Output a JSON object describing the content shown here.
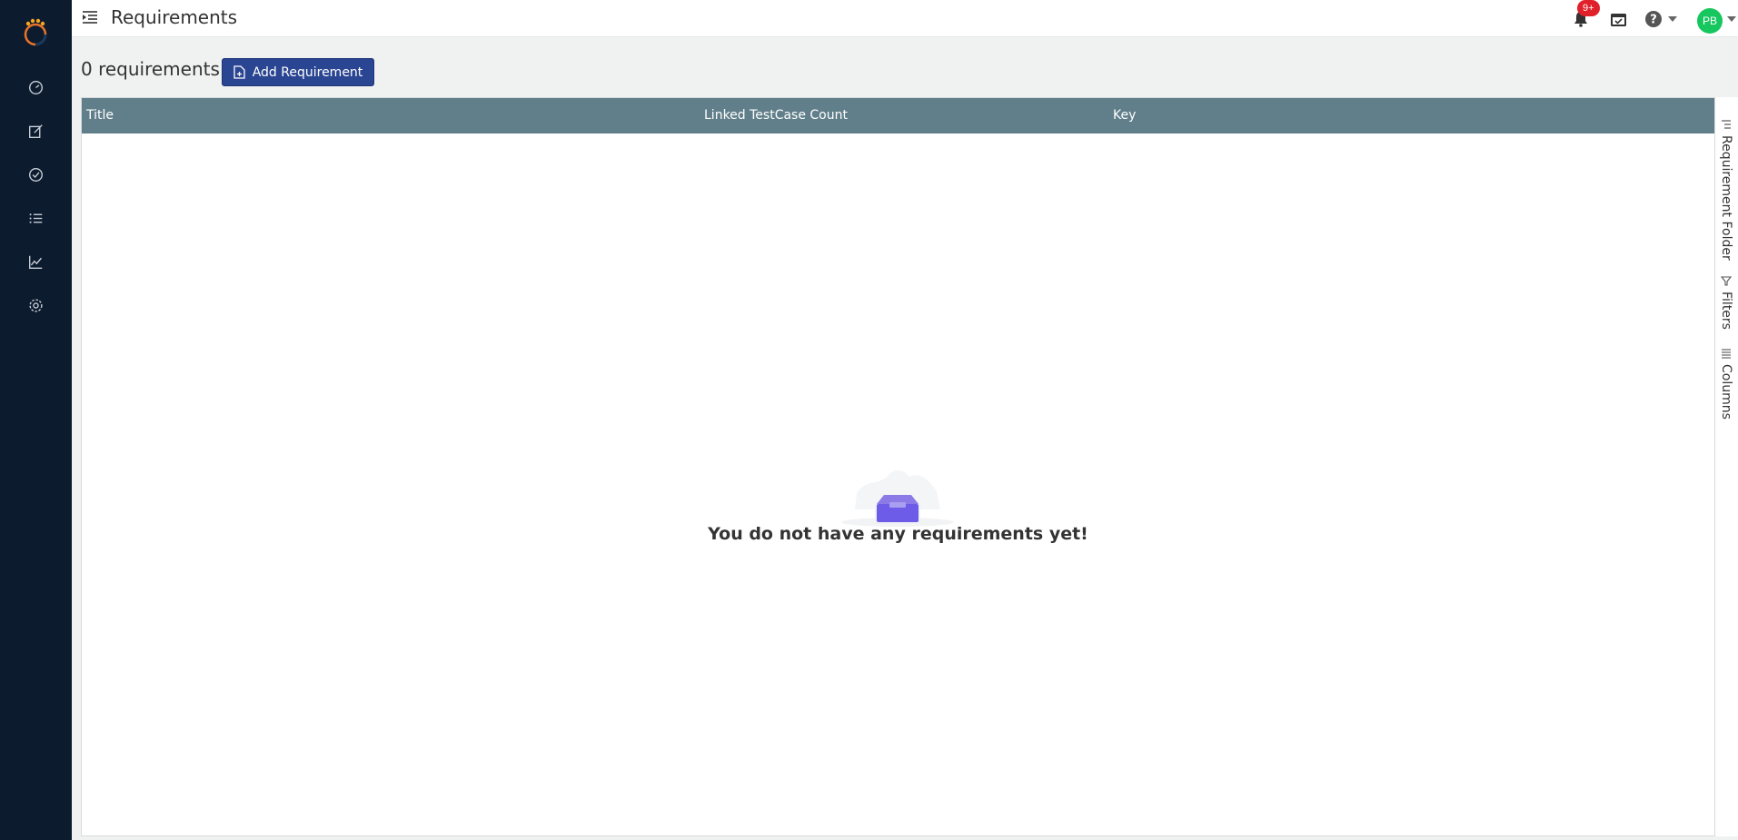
{
  "header": {
    "title": "Requirements",
    "notification_count": "9+",
    "avatar_initials": "PB"
  },
  "toolbar": {
    "count_label": "0 requirements",
    "add_button_label": "Add Requirement"
  },
  "grid": {
    "columns": [
      "Title",
      "Linked TestCase Count",
      "Key"
    ],
    "empty_message": "You do not have any requirements yet!"
  },
  "side_tabs": [
    "Requirement Folder",
    "Filters",
    "Columns"
  ],
  "sidebar": {
    "icons": [
      "dashboard-icon",
      "edit-icon",
      "check-circle-icon",
      "list-icon",
      "chart-icon",
      "settings-icon"
    ]
  },
  "colors": {
    "sidebar_bg": "#0d1b2e",
    "grid_header_bg": "#617f8a",
    "primary_button": "#2a4591",
    "badge": "#e0202b",
    "avatar": "#16c65e"
  }
}
